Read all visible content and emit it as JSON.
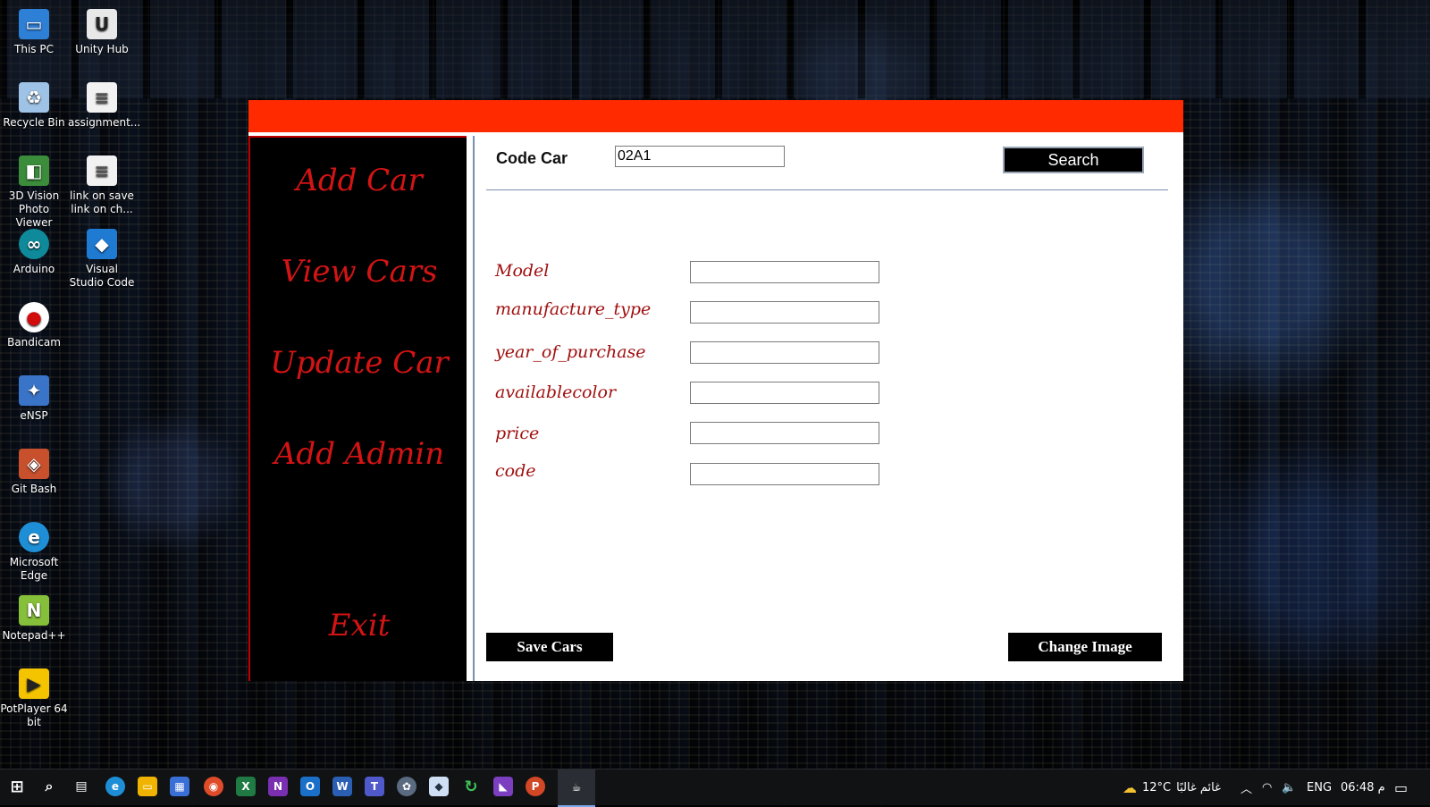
{
  "desktop": {
    "icons": [
      {
        "label": "This PC",
        "color": "#2e7fd6",
        "glyph": "🖥"
      },
      {
        "label": "Unity Hub",
        "color": "#e8e8e8",
        "glyph": "U"
      },
      {
        "label": "Recycle Bin",
        "color": "#9fc3e6",
        "glyph": "♻"
      },
      {
        "label": "assignment...",
        "color": "#f2f2f2",
        "glyph": "≡"
      },
      {
        "label": "3D Vision Photo Viewer",
        "color": "#3b8c3b",
        "glyph": "◧"
      },
      {
        "label": "link on save link on ch...",
        "color": "#f2f2f2",
        "glyph": "≡"
      },
      {
        "label": "Arduino",
        "color": "#0e8a9a",
        "glyph": "∞"
      },
      {
        "label": "Visual Studio Code",
        "color": "#1f7ad1",
        "glyph": "◆"
      },
      {
        "label": "Bandicam",
        "color": "#d10a0a",
        "glyph": "●"
      },
      {
        "label": "eNSP",
        "color": "#3a74c8",
        "glyph": "✦"
      },
      {
        "label": "Git Bash",
        "color": "#c9502d",
        "glyph": "◈"
      },
      {
        "label": "Microsoft Edge",
        "color": "#1e8fd6",
        "glyph": "e"
      },
      {
        "label": "Notepad++",
        "color": "#86c03a",
        "glyph": "N"
      },
      {
        "label": "PotPlayer 64 bit",
        "color": "#f5c400",
        "glyph": "▶"
      }
    ]
  },
  "app": {
    "nav": {
      "add_car": "Add Car",
      "view_cars": "View Cars",
      "update_car": "Update Car",
      "add_admin": "Add Admin",
      "exit": "Exit"
    },
    "search": {
      "label": "Code Car",
      "value": "02A1",
      "button": "Search"
    },
    "fields": {
      "model": "Model",
      "manufacture_type": "manufacture_type",
      "year_of_purchase": "year_of_purchase",
      "availablecolor": "availablecolor",
      "price": "price",
      "code": "code"
    },
    "buttons": {
      "save": "Save Cars",
      "change_image": "Change Image"
    },
    "colors": {
      "titlebar": "#ff2a00",
      "nav_text": "#d41414",
      "field_label": "#a01010"
    }
  },
  "taskbar": {
    "weather_temp": "12°C",
    "weather_desc": "غائم غالبًا",
    "language": "ENG",
    "time": "06:48 م"
  }
}
